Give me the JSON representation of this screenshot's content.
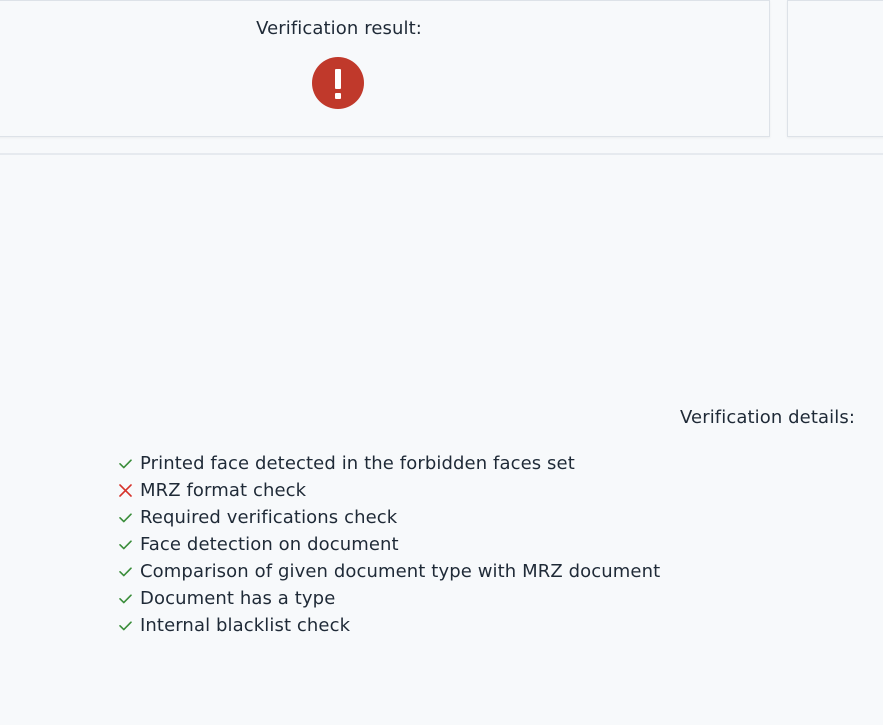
{
  "verification": {
    "result_label": "Verification result:",
    "result_status": "failed",
    "result_icon": "exclamation-icon",
    "result_color": "#c0392b"
  },
  "details": {
    "label": "Verification details:",
    "checks": [
      {
        "label": "Printed face detected in the forbidden faces set",
        "status": "passed",
        "icon": "check-icon",
        "color": "#3a8d3a"
      },
      {
        "label": "MRZ format check",
        "status": "failed",
        "icon": "cross-icon",
        "color": "#d6332b"
      },
      {
        "label": "Required verifications check",
        "status": "passed",
        "icon": "check-icon",
        "color": "#3a8d3a"
      },
      {
        "label": "Face detection on document",
        "status": "passed",
        "icon": "check-icon",
        "color": "#3a8d3a"
      },
      {
        "label": "Comparison of given document type with MRZ document",
        "status": "passed",
        "icon": "check-icon",
        "color": "#3a8d3a"
      },
      {
        "label": "Document has a type",
        "status": "passed",
        "icon": "check-icon",
        "color": "#3a8d3a"
      },
      {
        "label": "Internal blacklist check",
        "status": "passed",
        "icon": "check-icon",
        "color": "#3a8d3a"
      }
    ]
  }
}
